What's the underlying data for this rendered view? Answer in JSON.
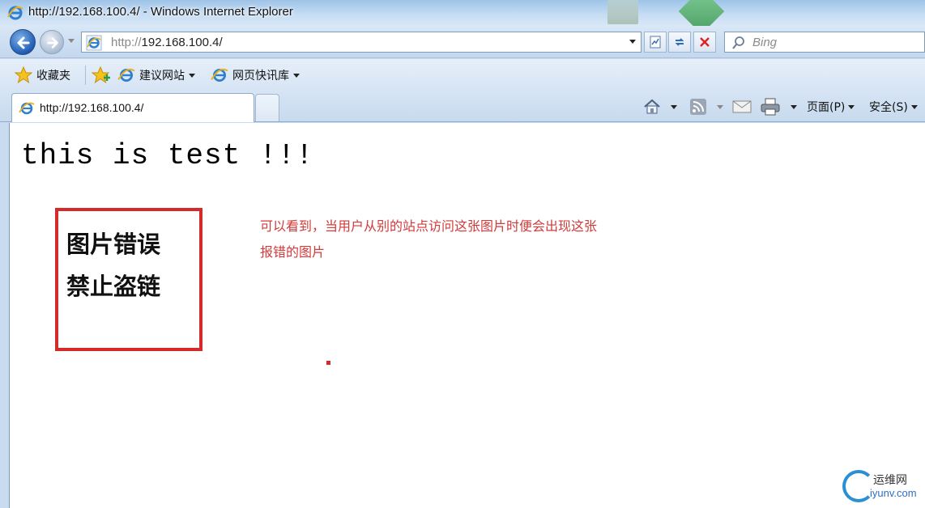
{
  "window": {
    "title": "http://192.168.100.4/ - Windows Internet Explorer"
  },
  "navigation": {
    "address_prefix": "http://",
    "address_host": "192.168.100.4/",
    "search_placeholder": "Bing"
  },
  "favorites_bar": {
    "favorites_label": "收藏夹",
    "items": [
      {
        "label": "建议网站"
      },
      {
        "label": "网页快讯库"
      }
    ]
  },
  "tabs": [
    {
      "label": "http://192.168.100.4/"
    }
  ],
  "command_bar": {
    "page_label": "页面(P)",
    "safety_label": "安全(S)"
  },
  "page": {
    "heading": "this is test !!!",
    "error_image": {
      "line1": "图片错误",
      "line2": "禁止盗链"
    },
    "note": "可以看到，当用户从别的站点访问这张图片时便会出现这张报错的图片"
  },
  "watermark": {
    "line1": "运维网",
    "line2": "iyunv.com"
  },
  "colors": {
    "accent": "#d42a2a",
    "note_text": "#d13b3b"
  }
}
